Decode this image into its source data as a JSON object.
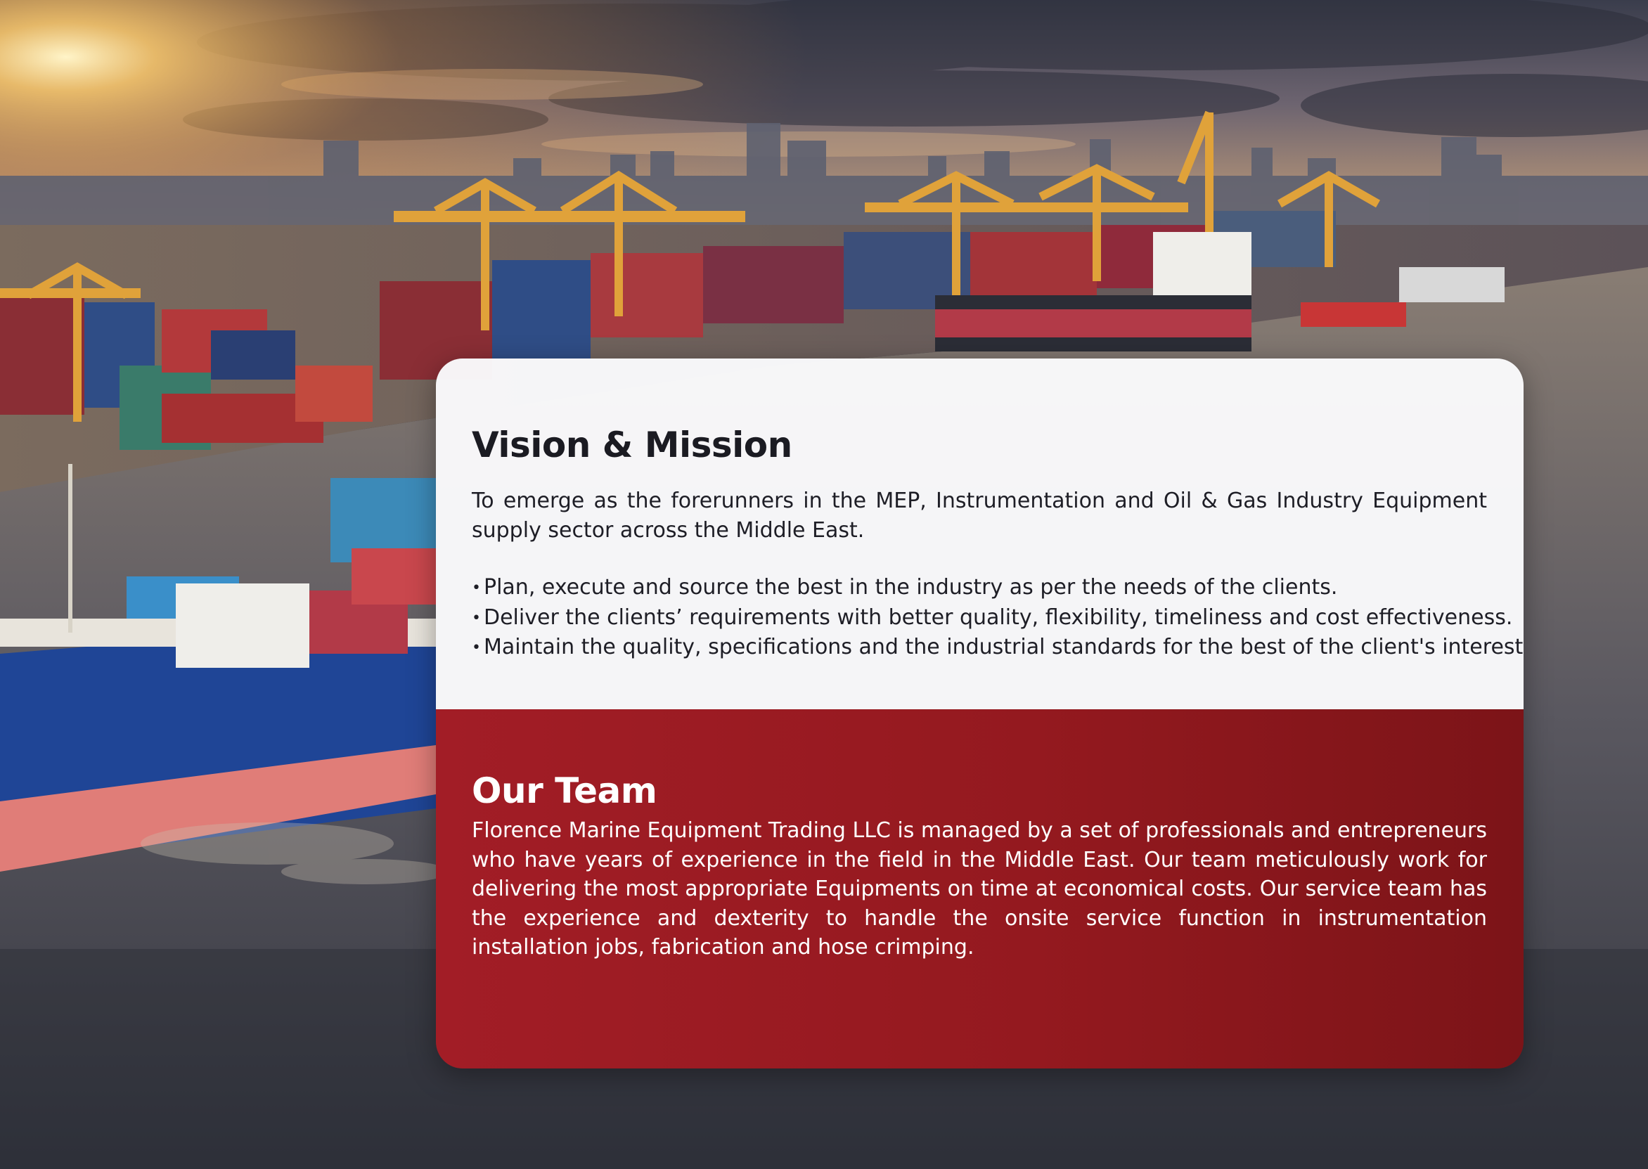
{
  "vision": {
    "heading": "Vision & Mission",
    "statement": "To emerge as the forerunners in the MEP, Instrumentation and Oil & Gas Industry Equipment supply sector across the Middle East.",
    "bullets": [
      "Plan, execute and source the best in the industry as per the needs of the clients.",
      "Deliver the clients’ requirements with better quality, flexibility, timeliness and cost effectiveness.",
      "Maintain the quality, specifications and the industrial standards for the best of the client's interest."
    ]
  },
  "team": {
    "heading": "Our Team",
    "body": "Florence Marine Equipment Trading LLC is managed by a set of professionals and entrepreneurs who have years of experience in the field in the Middle East. Our team meticulously work for delivering the most appropriate Equipments on time at economical costs. Our service team has the experience and dexterity to handle the onsite service function in instrumentation installation jobs, fabrication and hose crimping."
  },
  "colors": {
    "team_panel": "#9a1b22",
    "vision_panel": "#fafafc",
    "heading_dark": "#1b1b22"
  }
}
